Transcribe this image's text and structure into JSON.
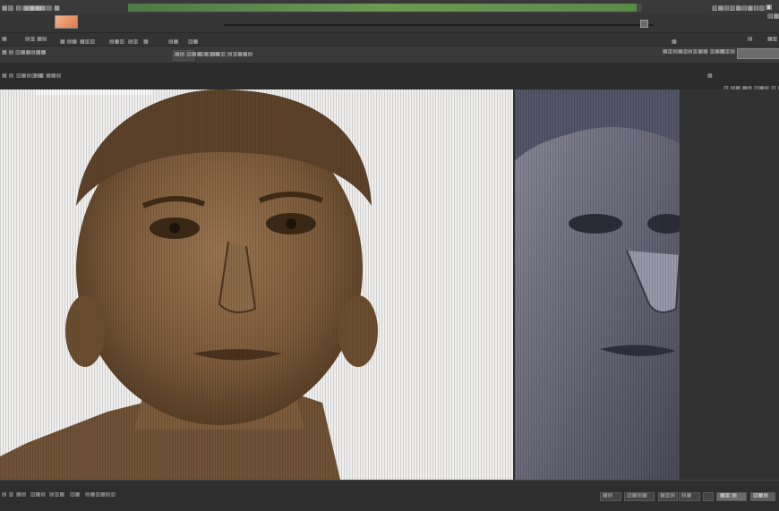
{
  "progress": {
    "fraction": 0.99
  },
  "menu": {
    "items": [
      "▦▥ ▤ ▦▦▦",
      "▤▥▦▦▤ ▦",
      "▦▦▥▤▥▤▥",
      "▤▥ ▦",
      "▤ ▥▦▦",
      "▦▦▤",
      "▤▦",
      "▥▦",
      "▦▥",
      "▦▤",
      "▥▤▦▦▤▥▤▥",
      "▦▥"
    ],
    "right_label": "▥▦▤▥▦▤▦▤▥",
    "right_icons": [
      "▣",
      "▤▦"
    ]
  },
  "options": {
    "items": [
      "▦",
      "▤▥ ▦▤",
      "▦ ▤▦",
      "▦▥▥",
      "▤▦▥",
      "▤▥",
      "▦",
      "▤▦",
      "▥▦"
    ],
    "right_items": [
      "▦",
      "▤",
      "▦▥"
    ]
  },
  "properties": {
    "items": [
      "▦ ▤ ▥▦▦▤▥▤",
      "▤▥",
      "▦▤ ▥▦▦",
      "▥▦▥▤",
      "▤▦▥ ▤▥▦▦▤"
    ],
    "right_items": [
      "▦▥▤▦▥",
      "▤▥▦▦ ▥▦▤",
      "▦▥▤"
    ]
  },
  "tabs": {
    "items": [
      "▦ ▤",
      "▥▦▤▥ ▦",
      "▤▥ ▦▦▤"
    ],
    "right": [
      "▦",
      "▥ ▤▦ ▦▤ ▥▦▤ ▥ ▦"
    ]
  },
  "status": {
    "items": [
      "▤ ▥",
      "▦▤",
      "▥▦▤",
      "▤▥▦",
      "▥▦",
      "▤▦▥▦▤▥"
    ],
    "buttons": [
      "▦▤",
      "▥▦▤▦",
      "▦▥▤",
      "▤▦",
      "▥▦",
      "▦▥ ▤",
      "▥▦▤"
    ]
  },
  "documents": {
    "main": {
      "subject": "sepia portrait bust, front view",
      "tint": "#7a5a3a"
    },
    "second": {
      "subject": "grayscale portrait, close crop",
      "tint": "#5a5a6a"
    }
  },
  "colors": {
    "accent": "#5f8f4a",
    "canvas_bg": "#efefef",
    "ui_bg": "#2f2f2f"
  }
}
